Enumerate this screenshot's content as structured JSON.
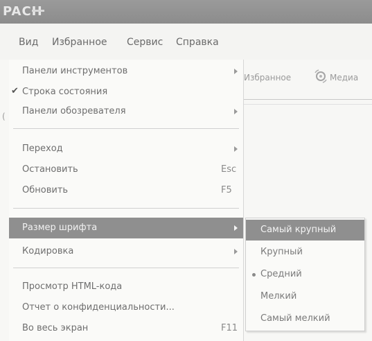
{
  "window": {
    "title": "PACH"
  },
  "menubar": {
    "items": [
      "Вид",
      "Избранное",
      "Сервис",
      "Справка"
    ]
  },
  "background": {
    "toolbar_label": "Избранное",
    "media_label": "Медиа",
    "left_mark": "("
  },
  "view_menu": {
    "items": [
      {
        "label": "Панели инструментов",
        "submenu": true
      },
      {
        "label": "Строка состояния",
        "checked": true
      },
      {
        "label": "Панели обозревателя",
        "submenu": true
      },
      {
        "label": "Переход",
        "submenu": true
      },
      {
        "label": "Остановить",
        "shortcut": "Esc"
      },
      {
        "label": "Обновить",
        "shortcut": "F5"
      },
      {
        "label": "Размер шрифта",
        "submenu": true,
        "highlighted": true
      },
      {
        "label": "Кодировка",
        "submenu": true
      },
      {
        "label": "Просмотр HTML-кода"
      },
      {
        "label": "Отчет о конфиденциальности..."
      },
      {
        "label": "Во весь экран",
        "shortcut": "F11"
      }
    ],
    "check_glyph": "✔"
  },
  "font_size_submenu": {
    "items": [
      {
        "label": "Самый крупный",
        "highlighted": true
      },
      {
        "label": "Крупный"
      },
      {
        "label": "Средний",
        "selected": true
      },
      {
        "label": "Мелкий"
      },
      {
        "label": "Самый мелкий"
      }
    ]
  },
  "colors": {
    "highlight": "#8f8f8f",
    "titlebar": "#949494"
  }
}
